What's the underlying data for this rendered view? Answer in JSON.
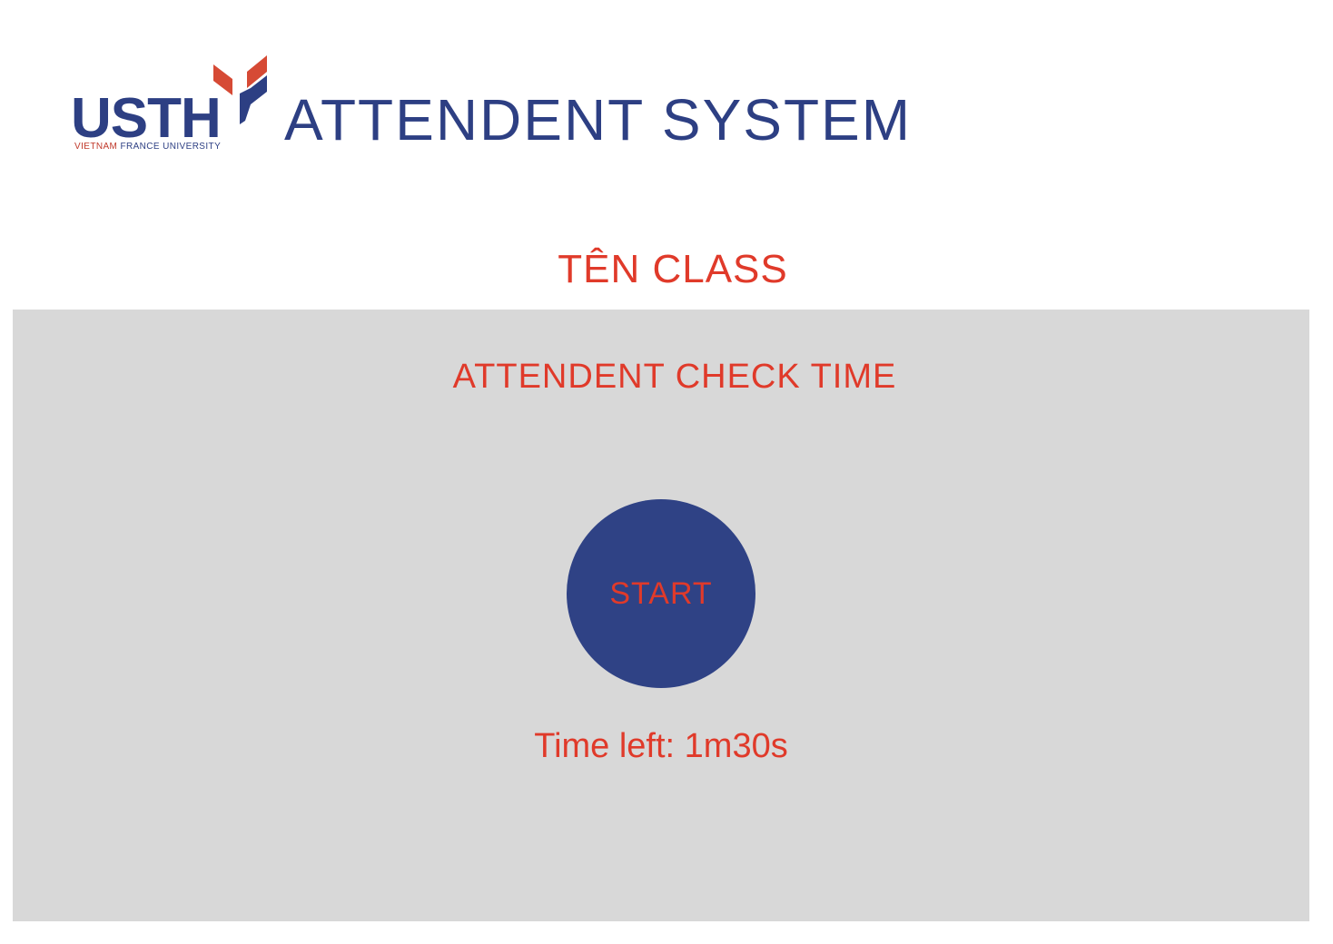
{
  "header": {
    "logo_text": "USTH",
    "logo_subtext_vietnam": "VIETNAM",
    "logo_subtext_rest": "FRANCE UNIVERSITY",
    "title": "ATTENDENT SYSTEM"
  },
  "class": {
    "name": "TÊN CLASS"
  },
  "attendance": {
    "title": "ATTENDENT CHECK TIME",
    "start_label": "START",
    "time_left": "Time left: 1m30s"
  },
  "colors": {
    "brand_blue": "#2d3f83",
    "accent_red": "#e03a2a",
    "panel_gray": "#d8d8d8"
  },
  "icons": {
    "logo": "usth-logo-icon"
  }
}
